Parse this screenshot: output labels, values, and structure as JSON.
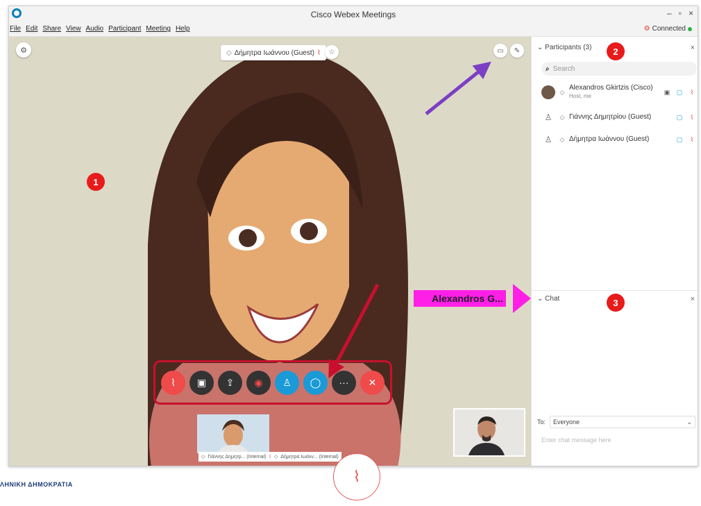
{
  "window": {
    "title": "Cisco Webex Meetings",
    "controls": [
      "–",
      "▫",
      "×"
    ]
  },
  "menu": {
    "items": [
      "File",
      "Edit",
      "Share",
      "View",
      "Audio",
      "Participant",
      "Meeting",
      "Help"
    ]
  },
  "status": {
    "connection": "Connected"
  },
  "stage": {
    "active_speaker": "Δήμητρα Ιωάννου (Guest)",
    "thumbnail_labels": [
      "Γιάννης Δημητρ... (Internal)",
      "Δήμητρα Ιωάνν... (Internal)"
    ]
  },
  "annotations": {
    "badges": [
      "1",
      "2",
      "3"
    ],
    "callout": "Alexandros G..."
  },
  "controls": [
    {
      "name": "mute",
      "icon": "mic-off-icon"
    },
    {
      "name": "video",
      "icon": "video-off-icon"
    },
    {
      "name": "share",
      "icon": "share-icon"
    },
    {
      "name": "record",
      "icon": "record-icon"
    },
    {
      "name": "participants",
      "icon": "participants-icon"
    },
    {
      "name": "chat",
      "icon": "chat-icon"
    },
    {
      "name": "more",
      "icon": "more-icon"
    },
    {
      "name": "leave",
      "icon": "close-icon"
    }
  ],
  "participants_panel": {
    "title": "Participants (3)",
    "search_placeholder": "Search",
    "people": [
      {
        "name": "Alexandros Gkirtzis (Cisco)",
        "sub": "Host, me"
      },
      {
        "name": "Γιάννης Δημητρίου (Guest)",
        "sub": ""
      },
      {
        "name": "Δήμητρα Ιωάννου (Guest)",
        "sub": ""
      }
    ]
  },
  "chat_panel": {
    "title": "Chat",
    "to_label": "To:",
    "to_value": "Everyone",
    "input_placeholder": "Enter chat message here"
  },
  "footer": {
    "text": "ΛΗΝΙΚΗ ΔΗΜΟΚΡΑΤΙΑ"
  },
  "colors": {
    "accent_blue": "#1a9ad6",
    "danger_red": "#ef4b4b",
    "badge_red": "#e81b1b",
    "callout_magenta": "#ff1fe6",
    "arrow_purple": "#7b3fc4",
    "arrow_red": "#c8102e"
  }
}
